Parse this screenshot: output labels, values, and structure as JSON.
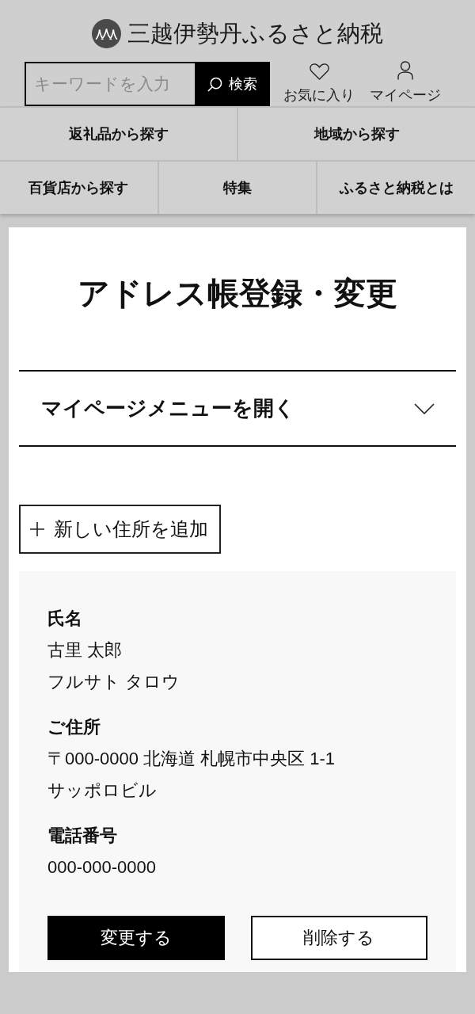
{
  "logo": {
    "text": "三越伊勢丹ふるさと納税"
  },
  "search": {
    "placeholder": "キーワードを入力",
    "button": "検索"
  },
  "header_links": [
    {
      "label": "お気に入り",
      "kind": "heart"
    },
    {
      "label": "マイページ",
      "kind": "person"
    }
  ],
  "nav_rows": [
    {
      "items": [
        "返礼品から探す",
        "地域から探す"
      ]
    },
    {
      "items": [
        "百貨店から探す",
        "特集",
        "ふるさと納税とは"
      ]
    }
  ],
  "page_title": "アドレス帳登録・変更",
  "mypage_menu": {
    "label": "マイページメニューを開く",
    "expanded": false
  },
  "add_button": {
    "label": "新しい住所を追加"
  },
  "address_card": {
    "sections": [
      {
        "label": "氏名",
        "lines": [
          "古里 太郎",
          "フルサト タロウ"
        ]
      },
      {
        "label": "ご住所",
        "lines": [
          "〒000-0000 北海道 札幌市中央区 1-1",
          "サッポロビル"
        ]
      },
      {
        "label": "電話番号",
        "lines": [
          "000-000-0000"
        ]
      }
    ],
    "buttons": [
      {
        "label": "変更する",
        "kind": "primary"
      },
      {
        "label": "削除する",
        "kind": "secondary"
      }
    ]
  }
}
